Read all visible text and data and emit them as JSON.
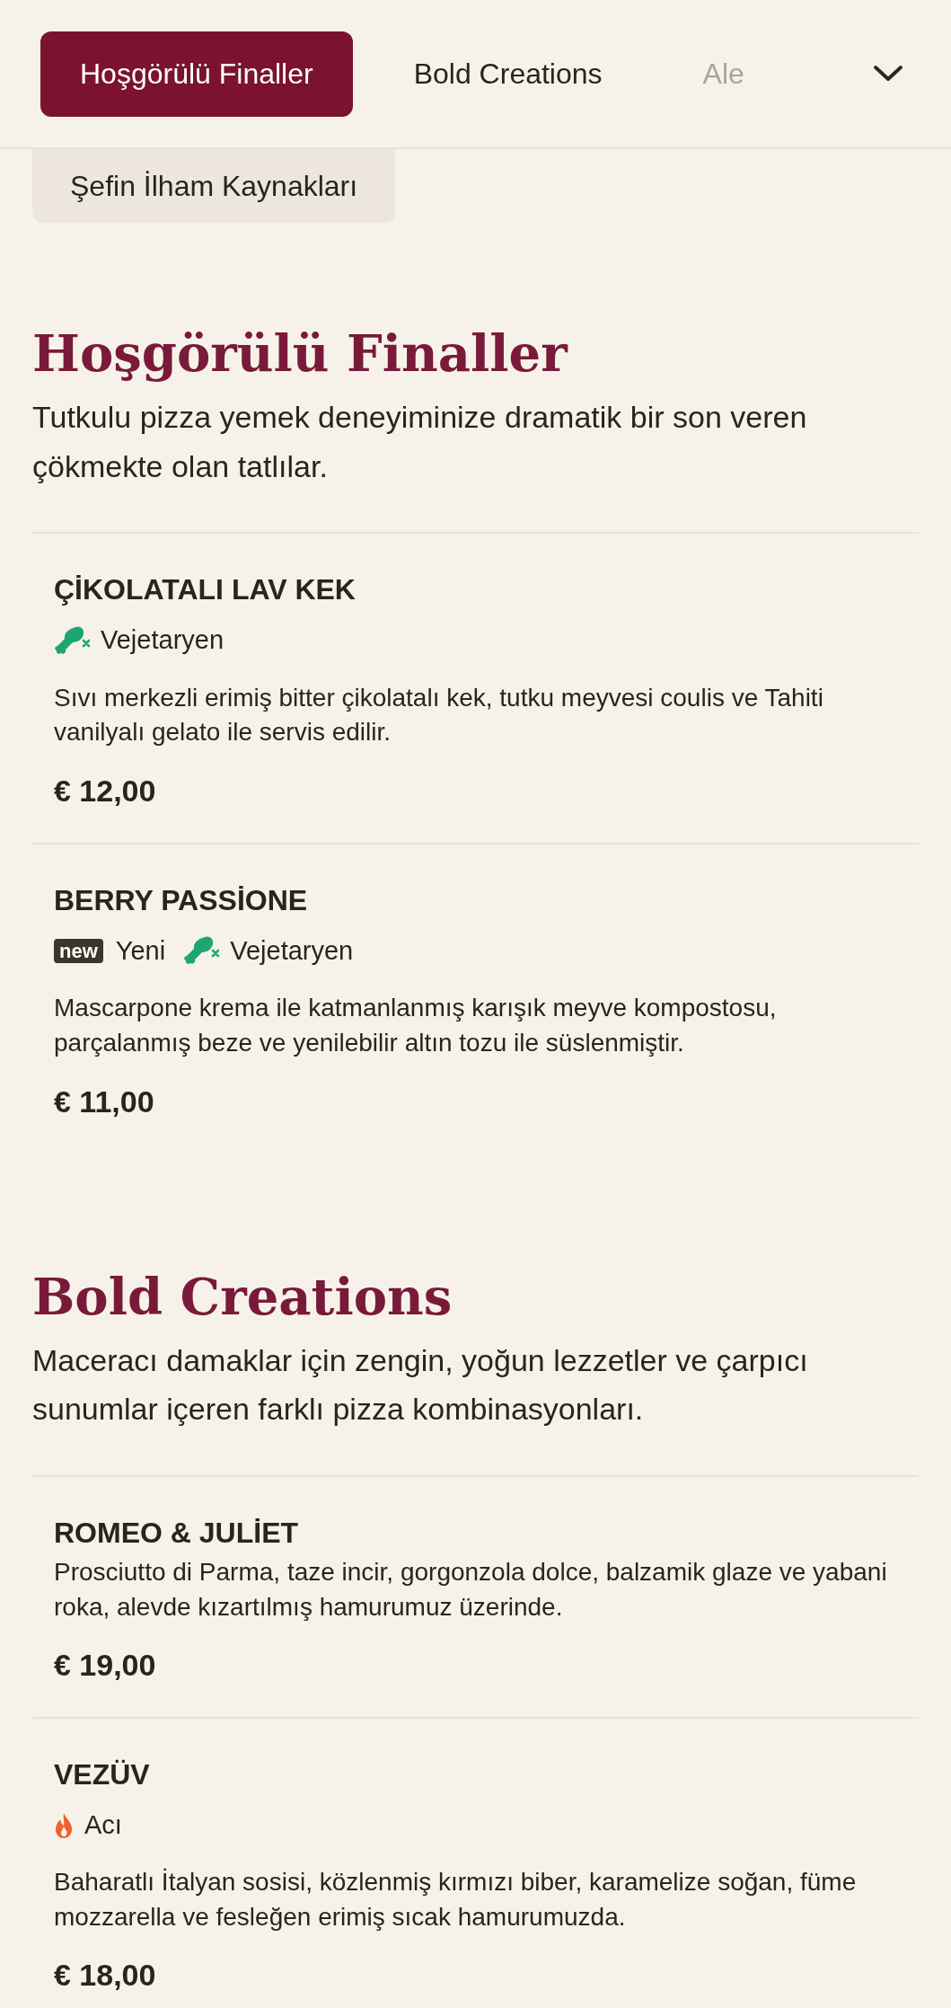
{
  "tabs": [
    {
      "label": "Hoşgörülü Finaller",
      "selected": true
    },
    {
      "label": "Bold Creations",
      "selected": false
    },
    {
      "label": "Ale",
      "selected": false
    }
  ],
  "sub_tabs": [
    {
      "label": "Şefin İlham Kaynakları",
      "selected": false
    }
  ],
  "sections": [
    {
      "title": "Hoşgörülü Finaller",
      "description": "Tutkulu pizza yemek deneyiminize dramatik bir son veren çökmekte olan tatlılar.",
      "items": [
        {
          "name": "ÇİKOLATALI LAV KEK",
          "tags": [
            {
              "kind": "vegetarian",
              "label": "Vejetaryen"
            }
          ],
          "description": "Sıvı merkezli erimiş bitter çikolatalı kek, tutku meyvesi coulis ve Tahiti vanilyalı gelato ile servis edilir.",
          "price": "€ 12,00"
        },
        {
          "name": "BERRY PASSİONE",
          "tags": [
            {
              "kind": "new",
              "badge": "new",
              "label": "Yeni"
            },
            {
              "kind": "vegetarian",
              "label": "Vejetaryen"
            }
          ],
          "description": "Mascarpone krema ile katmanlanmış karışık meyve kompostosu, parçalanmış beze ve yenilebilir altın tozu ile süslenmiştir.",
          "price": "€ 11,00"
        }
      ]
    },
    {
      "title": "Bold Creations",
      "description": "Maceracı damaklar için zengin, yoğun lezzetler ve çarpıcı sunumlar içeren farklı pizza kombinasyonları.",
      "items": [
        {
          "name": "ROMEO & JULİET",
          "description": "Prosciutto di Parma, taze incir, gorgonzola dolce, balzamik glaze ve yabani roka, alevde kızartılmış hamurumuz üzerinde.",
          "price": "€ 19,00"
        },
        {
          "name": "VEZÜV",
          "tags": [
            {
              "kind": "spicy",
              "label": "Acı"
            }
          ],
          "description": "Baharatlı İtalyan sosisi, közlenmiş kırmızı biber, karamelize soğan, füme mozzarella ve fesleğen erimiş sıcak hamurumuzda.",
          "price": "€ 18,00"
        }
      ]
    }
  ]
}
